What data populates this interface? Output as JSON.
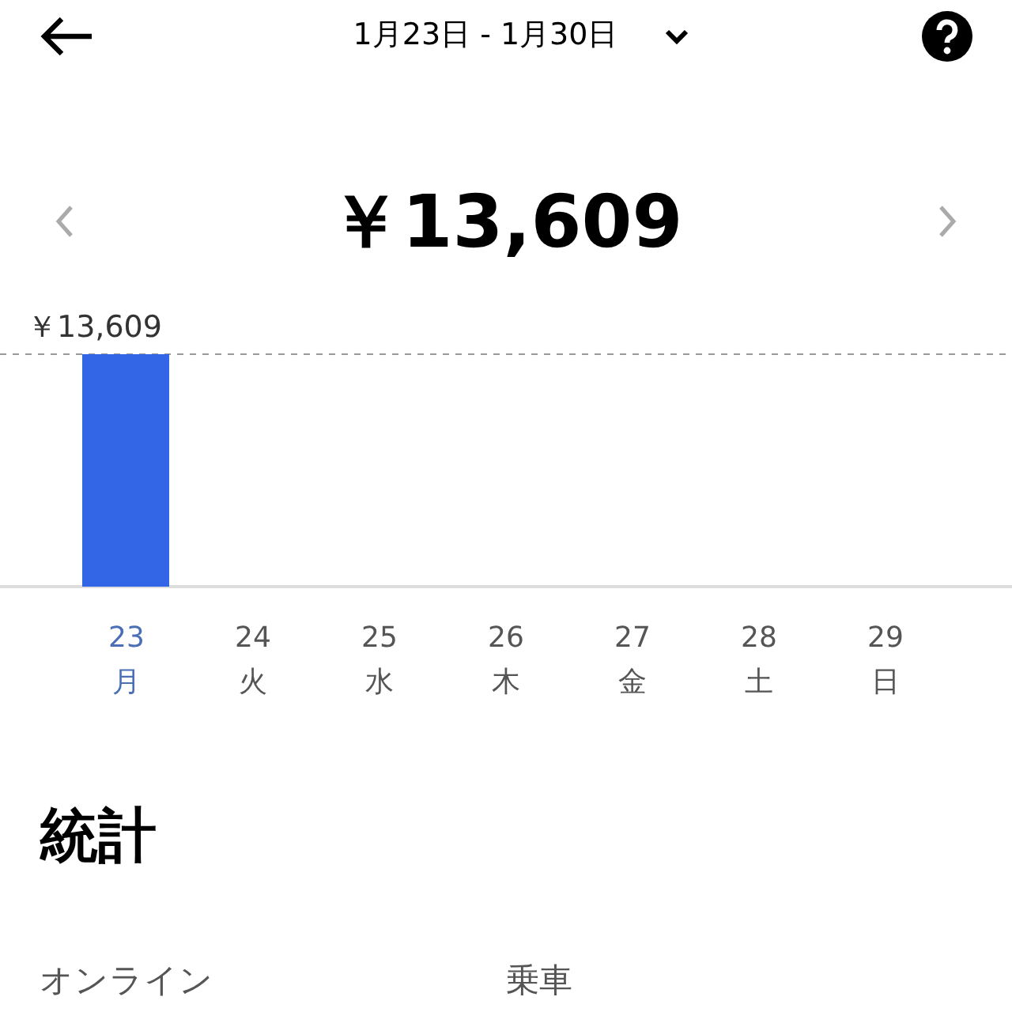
{
  "header": {
    "date_range": "1月23日 - 1月30日"
  },
  "total": "￥13,609",
  "chart_data": {
    "type": "bar",
    "categories": [
      "23",
      "24",
      "25",
      "26",
      "27",
      "28",
      "29"
    ],
    "values": [
      13609,
      0,
      0,
      0,
      0,
      0,
      0
    ],
    "value_labels": [
      "￥13,609",
      null,
      null,
      null,
      null,
      null,
      null
    ]
  },
  "weekdays": [
    {
      "label": "月",
      "selected": true
    },
    {
      "label": "火",
      "selected": false
    },
    {
      "label": "水",
      "selected": false
    },
    {
      "label": "木",
      "selected": false
    },
    {
      "label": "金",
      "selected": false
    },
    {
      "label": "土",
      "selected": false
    },
    {
      "label": "日",
      "selected": false
    }
  ],
  "stats": {
    "title": "統計",
    "labels": [
      "オンライン",
      "乗車"
    ]
  }
}
